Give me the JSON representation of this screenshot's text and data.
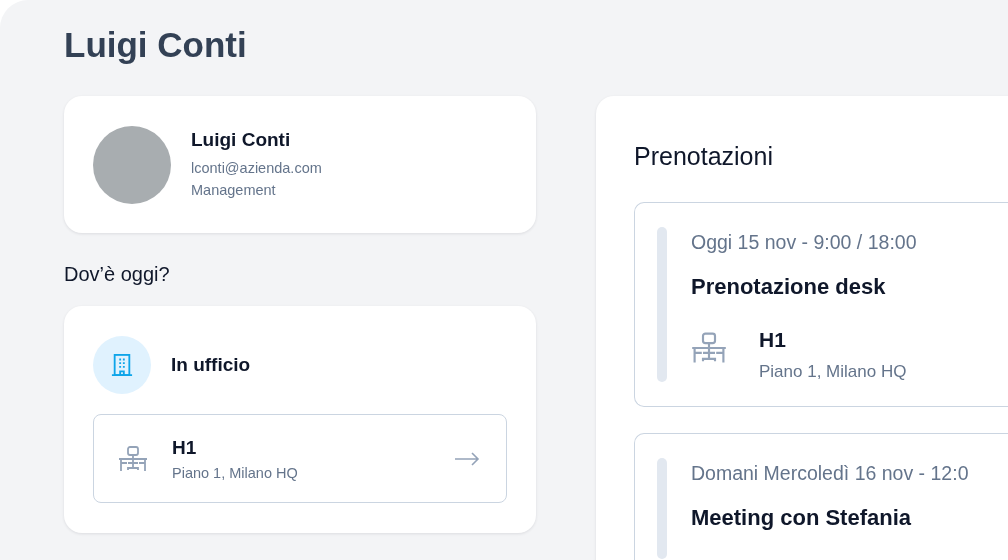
{
  "page": {
    "title": "Luigi Conti"
  },
  "profile": {
    "name": "Luigi Conti",
    "email": "lconti@azienda.com",
    "department": "Management"
  },
  "today": {
    "heading": "Dov’è oggi?",
    "status": {
      "kind": "office",
      "label": "In ufficio"
    },
    "desk": {
      "name": "H1",
      "location": "Piano 1, Milano HQ"
    }
  },
  "bookings": {
    "heading": "Prenotazioni",
    "items": [
      {
        "kind": "desk",
        "when": "Oggi 15 nov - 9:00 / 18:00",
        "title": "Prenotazione desk",
        "desk": "H1",
        "location": "Piano 1, Milano HQ"
      },
      {
        "kind": "meeting",
        "when": "Domani Mercoledì 16 nov - 12:0",
        "title": "Meeting con Stefania"
      }
    ]
  }
}
